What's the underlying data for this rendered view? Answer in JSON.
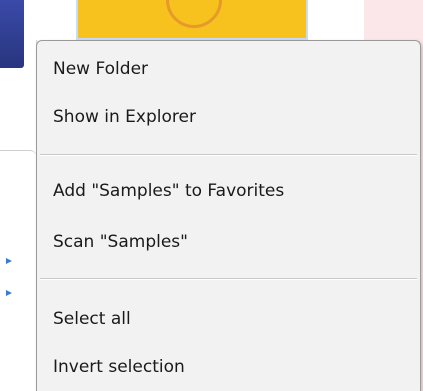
{
  "context_menu": {
    "items": [
      {
        "label": "New Folder"
      },
      {
        "label": "Show in Explorer"
      },
      {
        "label": "Add \"Samples\" to Favorites"
      },
      {
        "label": "Scan \"Samples\""
      },
      {
        "label": "Select all"
      },
      {
        "label": "Invert selection"
      }
    ]
  },
  "colors": {
    "menu_background": "#f2f2f2",
    "menu_border": "#9a9a9a",
    "separator": "#c8c8c8",
    "yellow_thumbnail": "#f8c21e",
    "pink_thumbnail": "#fbe7ea",
    "blue_thumbnail": "#3a4aa8"
  }
}
